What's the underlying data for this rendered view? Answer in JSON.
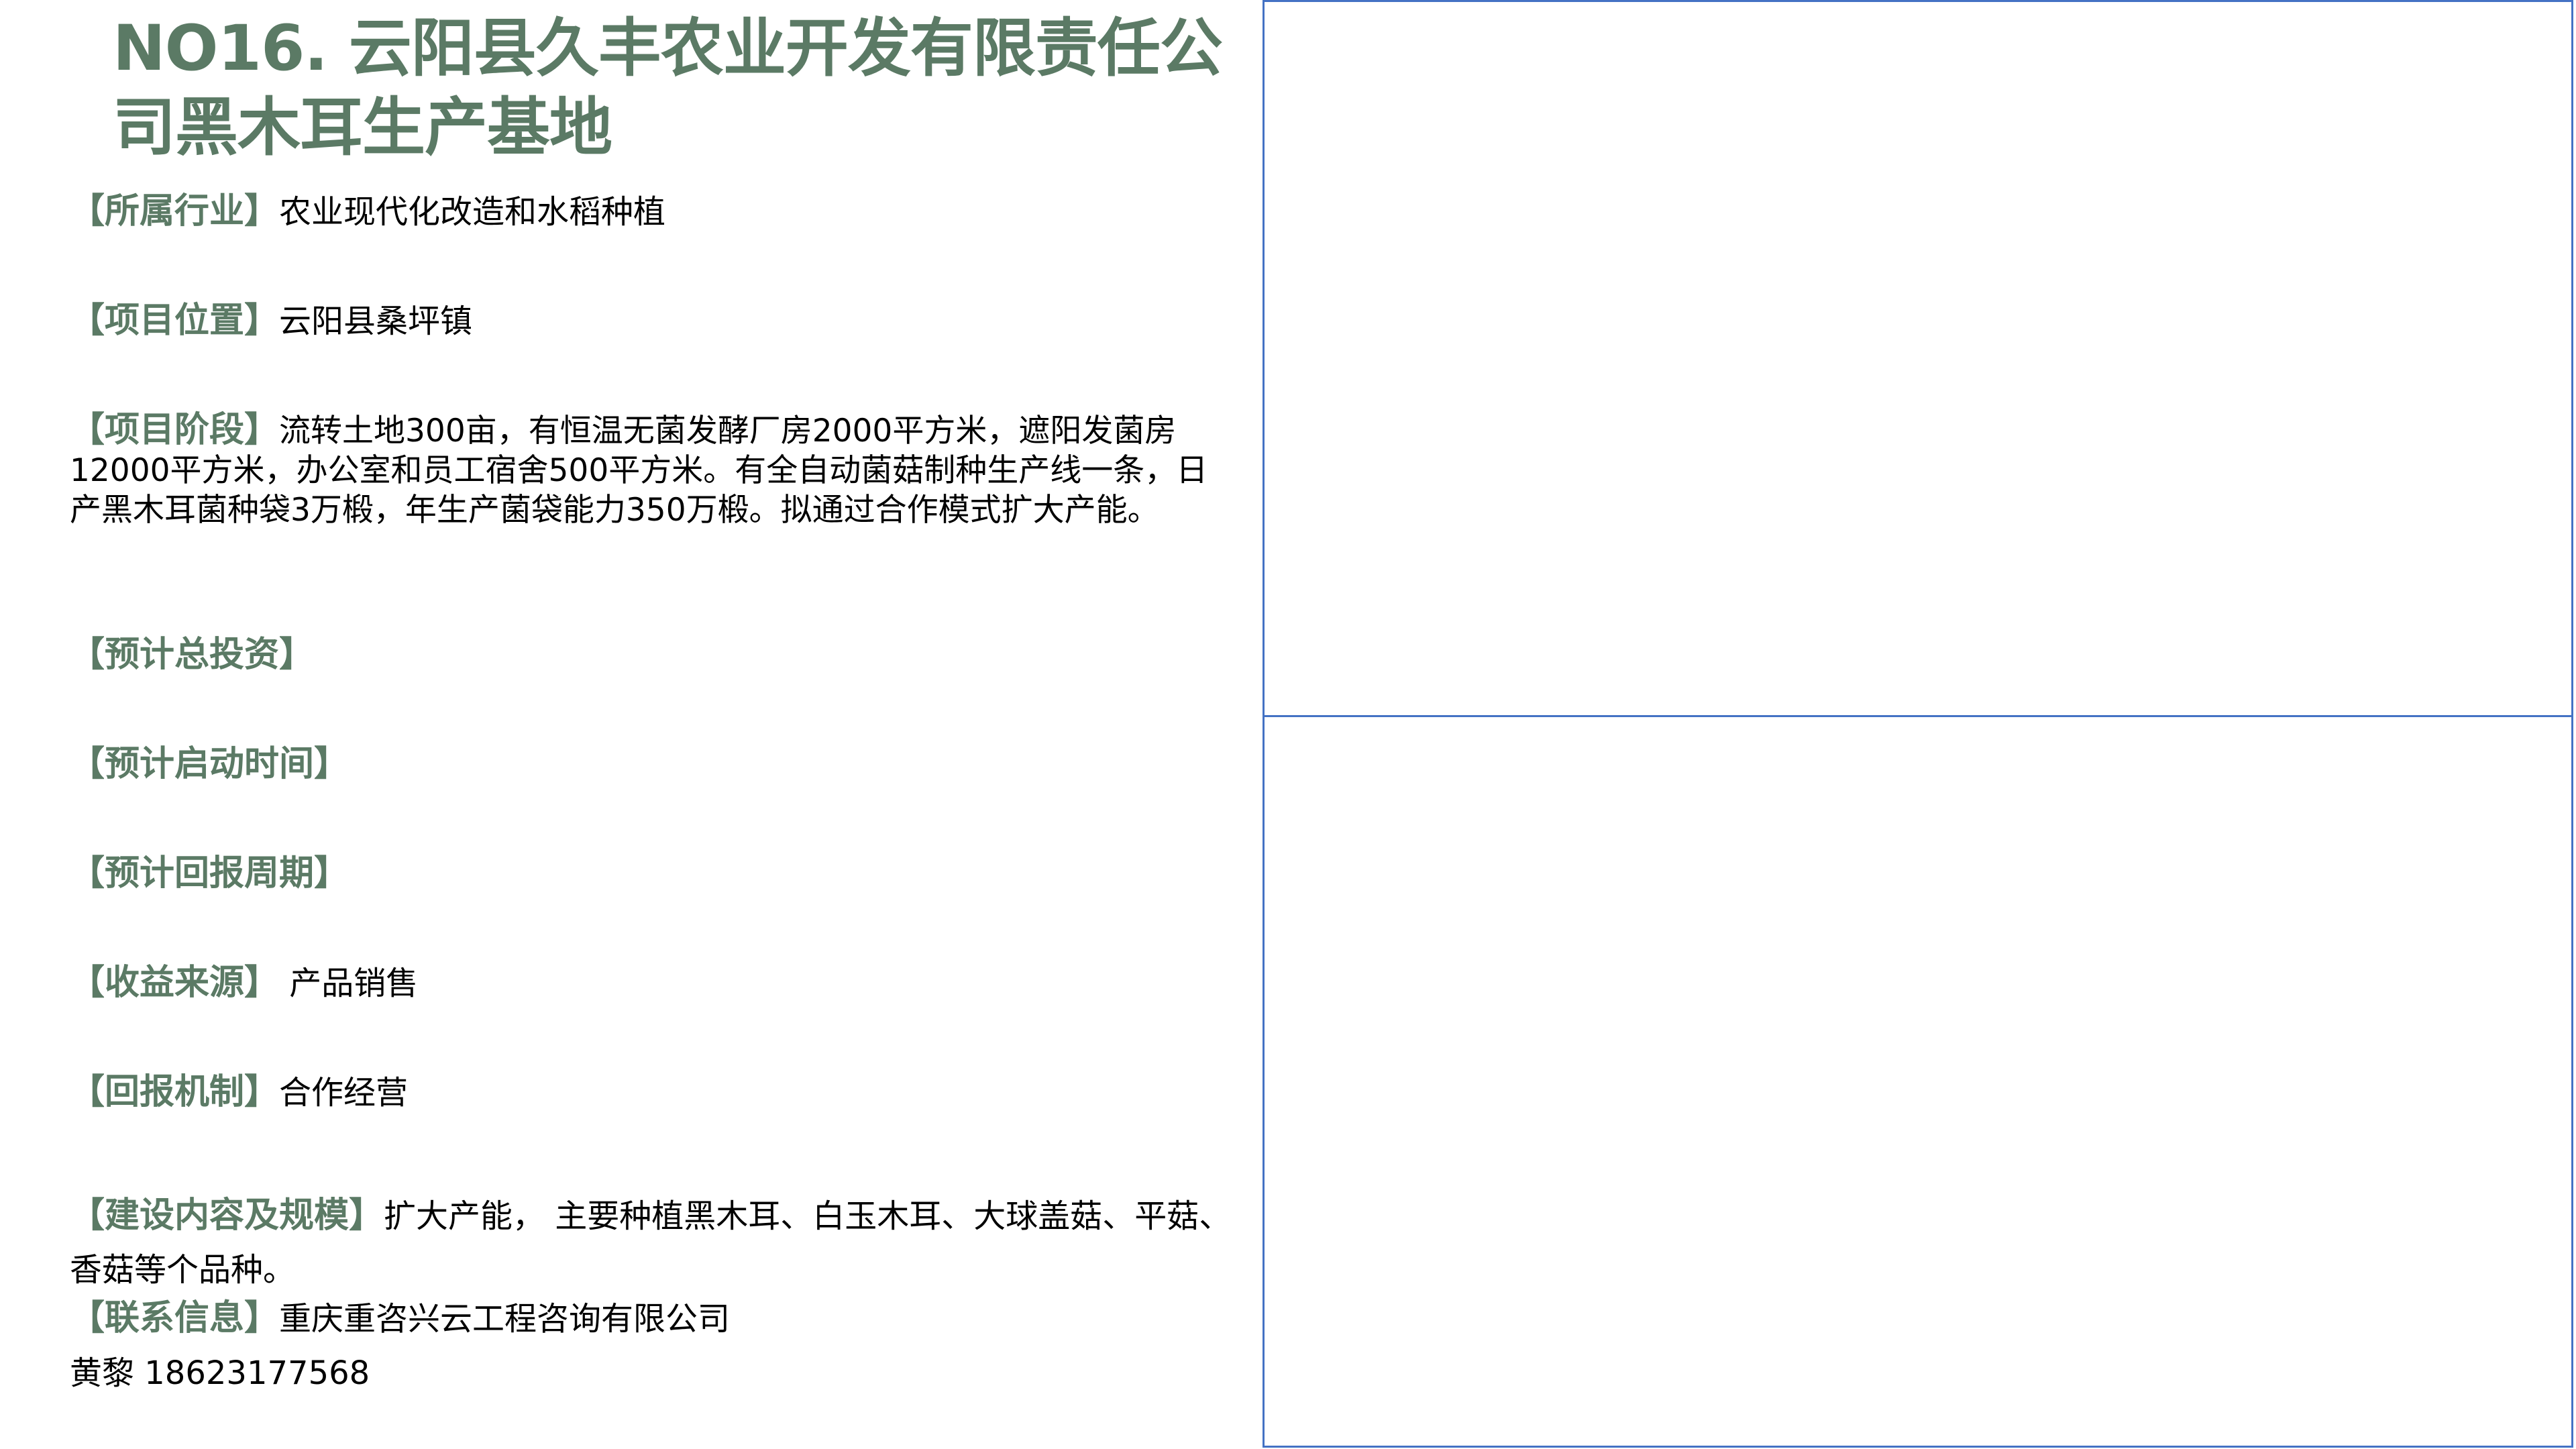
{
  "title": "NO16. 云阳县久丰农业开发有限责任公司黑木耳生产基地",
  "fields": [
    {
      "label": "【所属行业】",
      "value": "农业现代化改造和水稻种植"
    },
    {
      "label": "【项目位置】",
      "value": "云阳县桑坪镇"
    },
    {
      "label": "【项目阶段】",
      "value": "流转土地300亩，有恒温无菌发酵厂房2000平方米，遮阳发菌房12000平方米，办公室和员工宿舍500平方米。有全自动菌菇制种生产线一条，日产黑木耳菌种袋3万椴，年生产菌袋能力350万椴。拟通过合作模式扩大产能。"
    },
    {
      "label": "【预计总投资】",
      "value": ""
    },
    {
      "label": "【预计启动时间】",
      "value": ""
    },
    {
      "label": "【预计回报周期】",
      "value": ""
    },
    {
      "label": "【收益来源】",
      "value": " 产品销售"
    },
    {
      "label": "【回报机制】",
      "value": "合作经营"
    },
    {
      "label": "【建设内容及规模】",
      "value": "扩大产能， 主要种植黑木耳、白玉木耳、大球盖菇、平菇、香菇等个品种。"
    },
    {
      "label": "【联系信息】",
      "value": "重庆重咨兴云工程咨询有限公司"
    }
  ],
  "contact_person": "黄黎 18623177568",
  "colors": {
    "accent": "#5b7a65",
    "image_border": "#4472c4"
  }
}
